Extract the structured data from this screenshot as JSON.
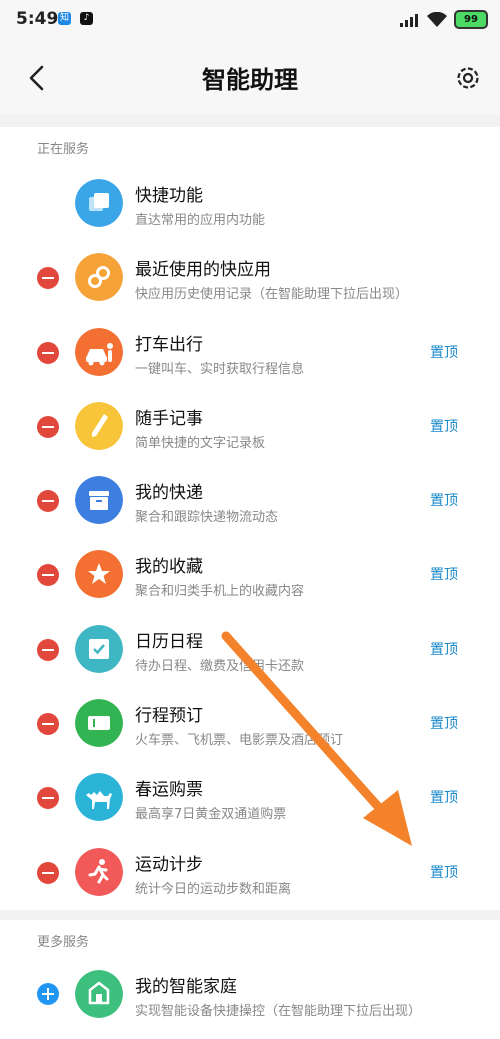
{
  "status_bar": {
    "time": "5:49",
    "app1": "知",
    "battery": "99"
  },
  "header": {
    "title": "智能助理"
  },
  "section_active": {
    "label": "正在服务",
    "pin_label": "置顶",
    "items": [
      {
        "title": "快捷功能",
        "subtitle": "直达常用的应用内功能"
      },
      {
        "title": "最近使用的快应用",
        "subtitle": "快应用历史使用记录（在智能助理下拉后出现）"
      },
      {
        "title": "打车出行",
        "subtitle": "一键叫车、实时获取行程信息"
      },
      {
        "title": "随手记事",
        "subtitle": "简单快捷的文字记录板"
      },
      {
        "title": "我的快递",
        "subtitle": "聚合和跟踪快递物流动态"
      },
      {
        "title": "我的收藏",
        "subtitle": "聚合和归类手机上的收藏内容"
      },
      {
        "title": "日历日程",
        "subtitle": "待办日程、缴费及信用卡还款"
      },
      {
        "title": "行程预订",
        "subtitle": "火车票、飞机票、电影票及酒店预订"
      },
      {
        "title": "春运购票",
        "subtitle": "最高享7日黄金双通道购票"
      },
      {
        "title": "运动计步",
        "subtitle": "统计今日的运动步数和距离"
      }
    ]
  },
  "section_more": {
    "label": "更多服务",
    "items": [
      {
        "title": "我的智能家庭",
        "subtitle": "实现智能设备快捷操控（在智能助理下拉后出现）"
      }
    ]
  },
  "colors": {
    "remove": "#e2473b",
    "add": "#2196f3",
    "pin": "#1a88c9",
    "arrow": "#f4822a",
    "icons": [
      "#3aa6e8",
      "#f5a237",
      "#f36f32",
      "#f8c53a",
      "#3d7fe0",
      "#f36f32",
      "#3fb6c4",
      "#33b452",
      "#2cb4d8",
      "#f25a5a",
      "#3dbf7e"
    ]
  },
  "icons": [
    "copy-icon",
    "link-icon",
    "taxi-icon",
    "pencil-icon",
    "box-icon",
    "star-icon",
    "calendar-icon",
    "ticket-icon",
    "camel-icon",
    "runner-icon",
    "mi-home-icon"
  ]
}
